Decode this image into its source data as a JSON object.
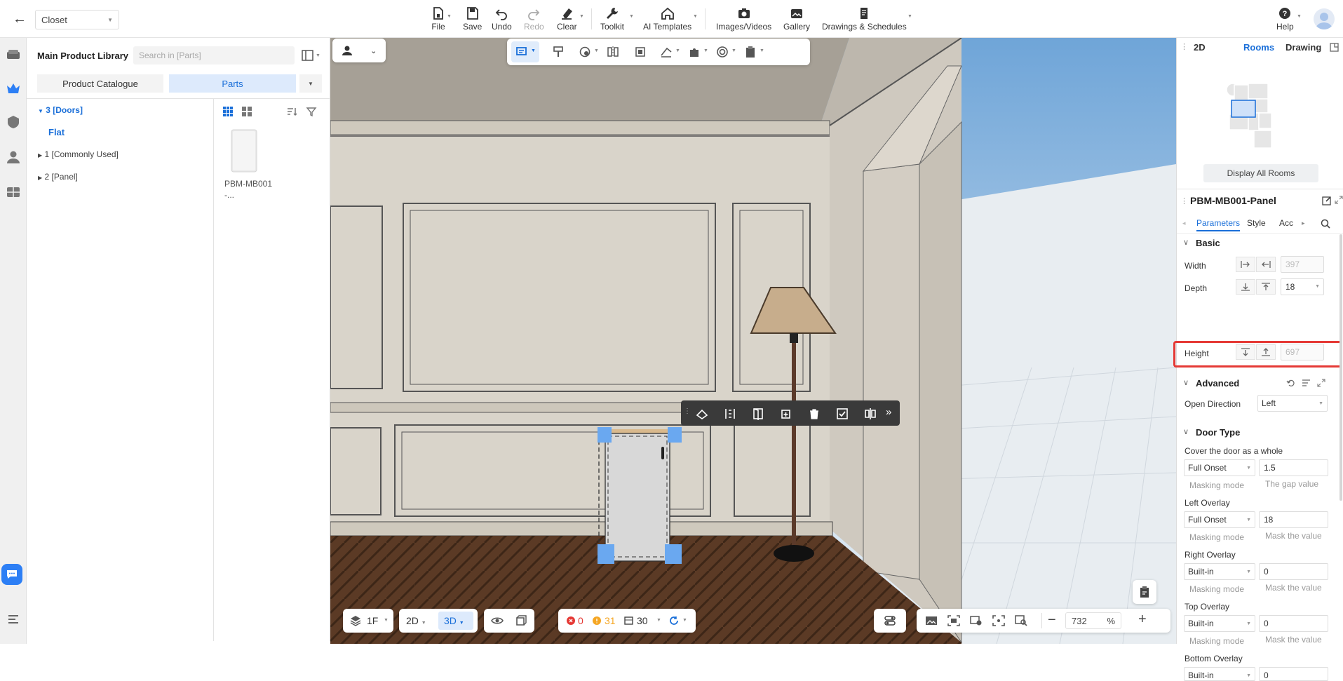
{
  "topbar": {
    "project": "Closet",
    "tools": [
      {
        "label": "File",
        "icon": "file-icon"
      },
      {
        "label": "Save",
        "icon": "save-icon"
      },
      {
        "label": "Undo",
        "icon": "undo-icon"
      },
      {
        "label": "Redo",
        "icon": "redo-icon"
      },
      {
        "label": "Clear",
        "icon": "eraser-icon"
      },
      {
        "label": "Toolkit",
        "icon": "wrench-icon"
      },
      {
        "label": "AI Templates",
        "icon": "ai-house-icon"
      },
      {
        "label": "Images/Videos",
        "icon": "camera-icon"
      },
      {
        "label": "Gallery",
        "icon": "gallery-icon"
      },
      {
        "label": "Drawings & Schedules",
        "icon": "drawings-icon"
      },
      {
        "label": "Help",
        "icon": "help-icon"
      }
    ]
  },
  "library": {
    "title": "Main Product Library",
    "search_placeholder": "Search in [Parts]",
    "tab_catalogue": "Product Catalogue",
    "tab_parts": "Parts",
    "tree": [
      {
        "label": "3 [Doors]",
        "expanded": true
      },
      {
        "label": "Flat"
      },
      {
        "label": "1 [Commonly Used]"
      },
      {
        "label": "2 [Panel]"
      }
    ],
    "product_name": "PBM-MB001-..."
  },
  "viewport": {
    "floor": "1F",
    "mode_2d": "2D",
    "mode_3d": "3D",
    "errors": "0",
    "warnings": "31",
    "count": "30",
    "zoom": "732",
    "zoom_unit": "%"
  },
  "rooms": {
    "tab_2d": "2D",
    "tab_rooms": "Rooms",
    "tab_drawing": "Drawing",
    "display_all": "Display All Rooms"
  },
  "props": {
    "title": "PBM-MB001-Panel",
    "tab_parameters": "Parameters",
    "tab_style": "Style",
    "tab_acc": "Acc",
    "basic": "Basic",
    "width_label": "Width",
    "width_value": "397",
    "depth_label": "Depth",
    "depth_value": "18",
    "height_label": "Height",
    "height_value": "697",
    "advanced": "Advanced",
    "open_direction_label": "Open Direction",
    "open_direction_value": "Left",
    "door_type": "Door Type",
    "cover_label": "Cover the door as a whole",
    "cover_mode": "Full Onset",
    "cover_gap": "1.5",
    "masking_mode": "Masking mode",
    "gap_value_hint": "The gap value",
    "left_overlay_label": "Left Overlay",
    "left_mode": "Full Onset",
    "left_value": "18",
    "mask_value_hint": "Mask the value",
    "right_overlay_label": "Right Overlay",
    "right_mode": "Built-in",
    "right_value": "0",
    "top_overlay_label": "Top Overlay",
    "top_mode": "Built-in",
    "top_value": "0",
    "bottom_overlay_label": "Bottom Overlay",
    "bottom_mode": "Built-in",
    "bottom_value": "0"
  },
  "colors": {
    "accent": "#1a6fd9",
    "highlight": "#e53935",
    "selection": "#6aa8f0"
  }
}
